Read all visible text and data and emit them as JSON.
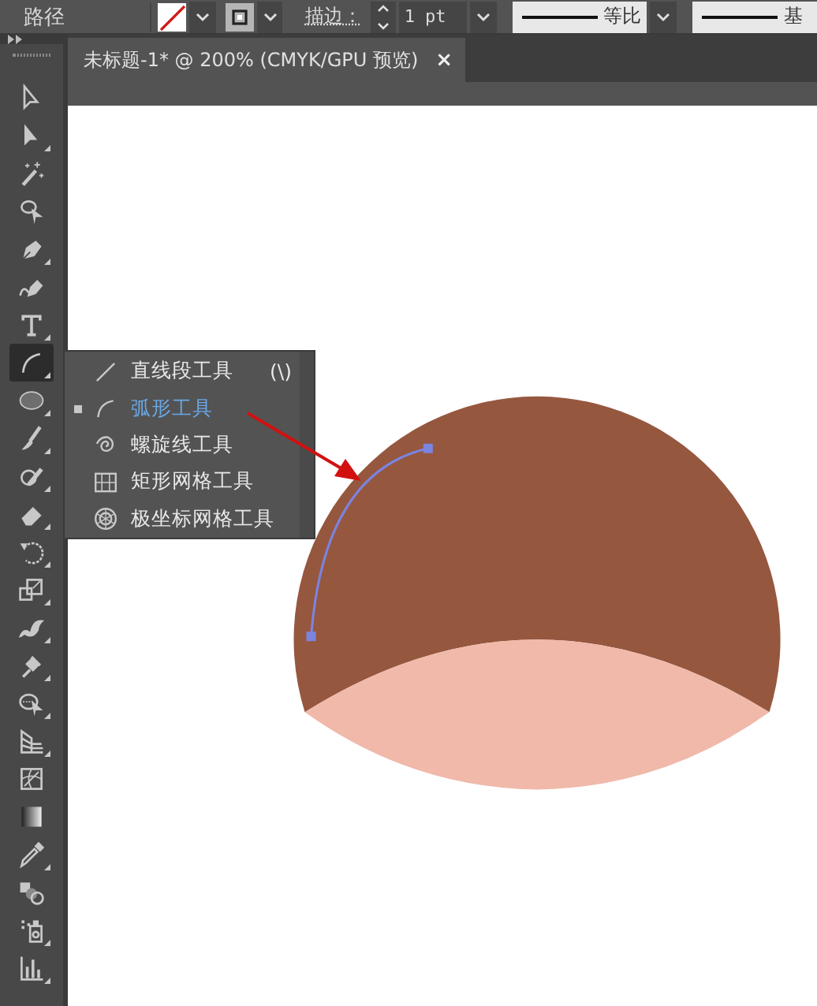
{
  "control_bar": {
    "label": "路径",
    "stroke_label": "描边：",
    "stroke_weight": "1 pt",
    "profile_1": "等比",
    "profile_2": "基"
  },
  "document_tab": {
    "title": "未标题-1* @ 200% (CMYK/GPU 预览)",
    "close": "×"
  },
  "tools": [
    {
      "kind": "select",
      "has_menu": false,
      "selected": false
    },
    {
      "kind": "direct",
      "has_menu": true,
      "selected": false
    },
    {
      "kind": "wand",
      "has_menu": false,
      "selected": false
    },
    {
      "kind": "lasso",
      "has_menu": false,
      "selected": false
    },
    {
      "kind": "pen",
      "has_menu": true,
      "selected": false
    },
    {
      "kind": "curvature",
      "has_menu": false,
      "selected": false
    },
    {
      "kind": "type",
      "has_menu": true,
      "selected": false
    },
    {
      "kind": "arc",
      "has_menu": true,
      "selected": true
    },
    {
      "kind": "ellipse",
      "has_menu": true,
      "selected": false
    },
    {
      "kind": "brush",
      "has_menu": true,
      "selected": false
    },
    {
      "kind": "shaper",
      "has_menu": true,
      "selected": false
    },
    {
      "kind": "eraser",
      "has_menu": true,
      "selected": false
    },
    {
      "kind": "rotate",
      "has_menu": true,
      "selected": false
    },
    {
      "kind": "scale",
      "has_menu": true,
      "selected": false
    },
    {
      "kind": "warp",
      "has_menu": true,
      "selected": false
    },
    {
      "kind": "pin",
      "has_menu": true,
      "selected": false
    },
    {
      "kind": "builder",
      "has_menu": true,
      "selected": false
    },
    {
      "kind": "perspective",
      "has_menu": true,
      "selected": false
    },
    {
      "kind": "mesh",
      "has_menu": false,
      "selected": false
    },
    {
      "kind": "gradient",
      "has_menu": false,
      "selected": false
    },
    {
      "kind": "eyedropper",
      "has_menu": true,
      "selected": false
    },
    {
      "kind": "blend",
      "has_menu": false,
      "selected": false
    },
    {
      "kind": "sprayer",
      "has_menu": true,
      "selected": false
    },
    {
      "kind": "graph",
      "has_menu": true,
      "selected": false
    }
  ],
  "flyout": [
    {
      "kind": "line",
      "label": "直线段工具",
      "shortcut": "(\\)",
      "selected": false
    },
    {
      "kind": "arc",
      "label": "弧形工具",
      "selected": true
    },
    {
      "kind": "spiral",
      "label": "螺旋线工具",
      "selected": false
    },
    {
      "kind": "grid",
      "label": "矩形网格工具",
      "selected": false
    },
    {
      "kind": "polar",
      "label": "极坐标网格工具",
      "selected": false
    }
  ]
}
